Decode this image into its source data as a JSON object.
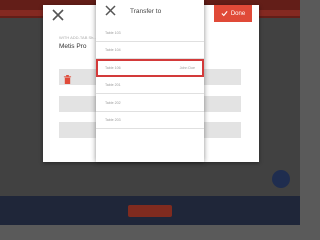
{
  "colors": {
    "accent": "#e04a38",
    "selection": "#d33a3a"
  },
  "dialog": {
    "pax_label": "WITH ADD-TAB Sh...",
    "item_name": "Metis Pro",
    "icons": {
      "close": "close-icon",
      "delete": "trash-icon"
    }
  },
  "transfer": {
    "title": "Transfer to",
    "close_icon": "close-icon",
    "done_label": "Done",
    "done_icon": "check-icon",
    "tables": [
      {
        "name": "Table 103",
        "user": ""
      },
      {
        "name": "Table 104",
        "user": ""
      },
      {
        "name": "Table 106",
        "user": "John Doe",
        "selected": true
      },
      {
        "name": "Table 201",
        "user": ""
      },
      {
        "name": "Table 202",
        "user": ""
      },
      {
        "name": "Table 203",
        "user": ""
      }
    ]
  }
}
